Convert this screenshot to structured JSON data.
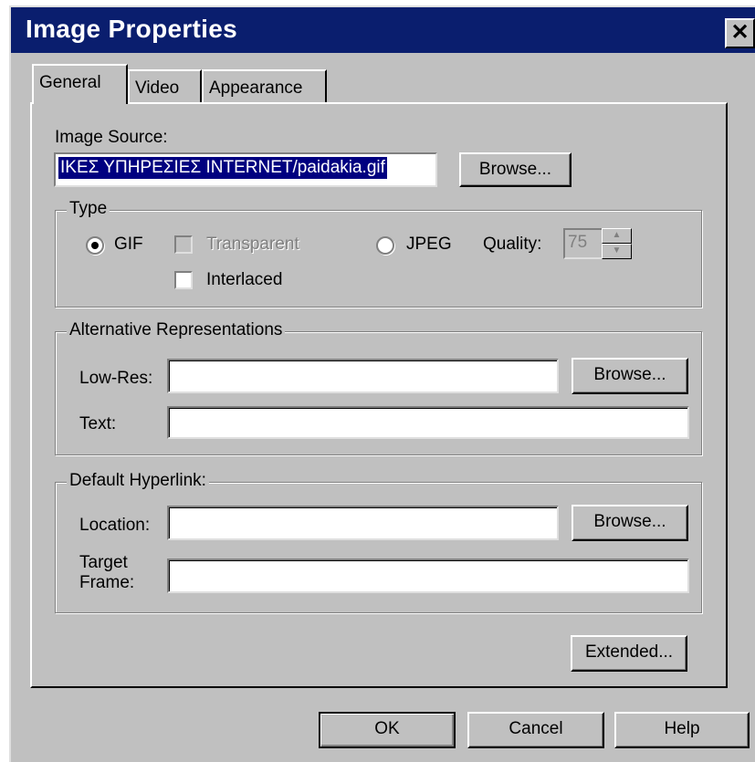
{
  "window": {
    "title": "Image Properties",
    "close_glyph": "✕"
  },
  "tabs": [
    {
      "label": "General",
      "active": true
    },
    {
      "label": "Video",
      "active": false
    },
    {
      "label": "Appearance",
      "active": false
    }
  ],
  "image_source": {
    "label": "Image Source:",
    "value": "ΙΚΕΣ ΥΠΗΡΕΣΙΕΣ INTERNET/paidakia.gif",
    "browse": "Browse..."
  },
  "type_group": {
    "legend": "Type",
    "gif": {
      "label": "GIF",
      "selected": true
    },
    "transparent": {
      "label": "Transparent",
      "checked": false,
      "enabled": false
    },
    "interlaced": {
      "label": "Interlaced",
      "checked": false
    },
    "jpeg": {
      "label": "JPEG",
      "selected": false
    },
    "quality": {
      "label": "Quality:",
      "value": "75",
      "enabled": false
    }
  },
  "alternative": {
    "legend": "Alternative Representations",
    "lowres_label": "Low-Res:",
    "lowres_value": "",
    "browse": "Browse...",
    "text_label": "Text:",
    "text_value": ""
  },
  "hyperlink": {
    "legend": "Default Hyperlink:",
    "location_label": "Location:",
    "location_value": "",
    "browse": "Browse...",
    "target_label_1": "Target",
    "target_label_2": "Frame:",
    "target_value": ""
  },
  "buttons": {
    "extended": "Extended...",
    "ok": "OK",
    "cancel": "Cancel",
    "help": "Help"
  }
}
